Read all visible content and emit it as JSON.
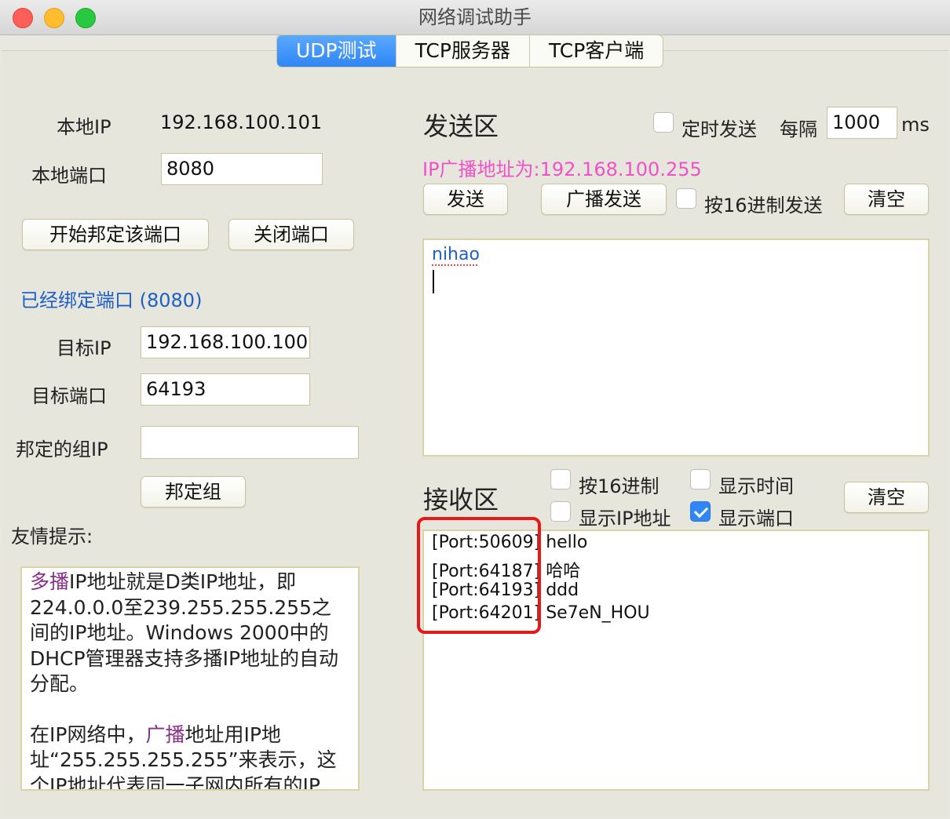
{
  "window": {
    "title": "网络调试助手"
  },
  "tabs": [
    {
      "label": "UDP测试",
      "active": true
    },
    {
      "label": "TCP服务器",
      "active": false
    },
    {
      "label": "TCP客户端",
      "active": false
    }
  ],
  "local": {
    "ip_label": "本地IP",
    "ip_value": "192.168.100.101",
    "port_label": "本地端口",
    "port_value": "8080",
    "bind_button": "开始邦定该端口",
    "close_button": "关闭端口",
    "bound_status": "已经绑定端口 (8080)"
  },
  "target": {
    "ip_label": "目标IP",
    "ip_value": "192.168.100.100",
    "port_label": "目标端口",
    "port_value": "64193",
    "group_label": "邦定的组IP",
    "group_value": "",
    "group_button": "邦定组"
  },
  "hint": {
    "label": "友情提示:",
    "p1_hl": "多播",
    "p1_rest": "IP地址就是D类IP地址，即224.0.0.0至239.255.255.255之间的IP地址。Windows 2000中的DHCP管理器支持多播IP地址的自动分配。",
    "p2_a": "在IP网络中，",
    "p2_hl": "广播",
    "p2_rest": "地址用IP地址“255.255.255.255”来表示，这个IP地址代表同一子网内所有的IP"
  },
  "send": {
    "title": "发送区",
    "timer_label": "定时发送",
    "timer_checked": false,
    "interval_label": "每隔",
    "interval_value": "1000",
    "unit": "ms",
    "broadcast_info": "IP广播地址为:192.168.100.255",
    "send_button": "发送",
    "broadcast_button": "广播发送",
    "hex_label": "按16进制发送",
    "hex_checked": false,
    "clear_button": "清空",
    "text": "nihao"
  },
  "recv": {
    "title": "接收区",
    "hex_label": "按16进制",
    "hex_checked": false,
    "show_time_label": "显示时间",
    "show_time_checked": false,
    "show_ip_label": "显示IP地址",
    "show_ip_checked": false,
    "show_port_label": "显示端口",
    "show_port_checked": true,
    "clear_button": "清空",
    "lines": [
      {
        "port": "[Port:50609]",
        "msg": "hello"
      },
      {
        "port": "[Port:64187]",
        "msg": "哈哈"
      },
      {
        "port": "[Port:64193]",
        "msg": "ddd"
      },
      {
        "port": "[Port:64201]",
        "msg": "Se7eN_HOU"
      }
    ]
  },
  "colors": {
    "accent": "#2f86f5",
    "broadcast_info": "#f050c8",
    "bound_status": "#1f5fc8",
    "highlight": "#8a2e8a",
    "annotation": "#e81818"
  }
}
